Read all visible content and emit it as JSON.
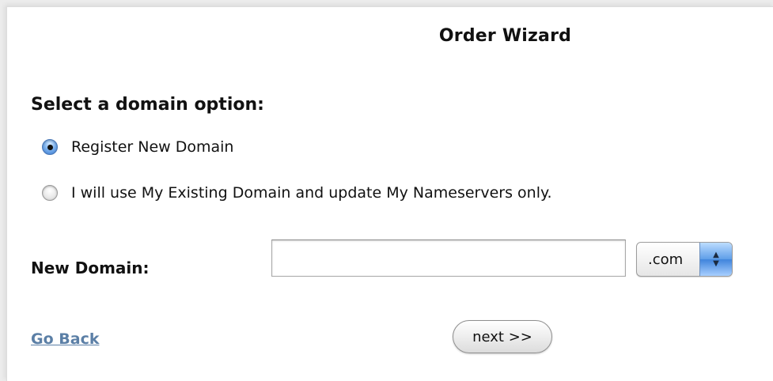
{
  "page": {
    "title": "Order Wizard"
  },
  "domain_option": {
    "heading": "Select a domain option:",
    "options": [
      {
        "label": "Register New Domain",
        "selected": true
      },
      {
        "label": "I will use My Existing Domain and update My Nameservers only.",
        "selected": false
      }
    ]
  },
  "new_domain": {
    "label": "New Domain:",
    "value": "",
    "placeholder": "",
    "tld_selected": ".com"
  },
  "actions": {
    "go_back_label": "Go Back",
    "next_label": "next >>"
  },
  "colors": {
    "link": "#5b7fa6",
    "radio_selected": "#3a7ad0",
    "select_arrows": "#5f9ee8"
  },
  "icons": {
    "radio_selected": "radio-selected-icon",
    "radio_unselected": "radio-unselected-icon",
    "select_arrows": "up-down-arrows-icon"
  }
}
